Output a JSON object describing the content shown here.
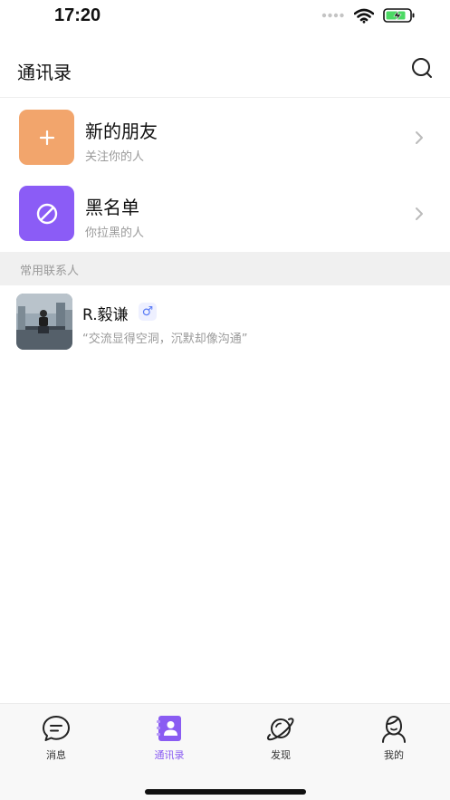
{
  "status_bar": {
    "time": "17:20"
  },
  "header": {
    "title": "通讯录",
    "search_icon": "search-icon"
  },
  "entries": [
    {
      "title": "新的朋友",
      "subtitle": "关注你的人",
      "icon": "plus-icon",
      "color": "#F2A56C"
    },
    {
      "title": "黑名单",
      "subtitle": "你拉黑的人",
      "icon": "block-icon",
      "color": "#8B5CF6"
    }
  ],
  "section": {
    "label": "常用联系人"
  },
  "contacts": [
    {
      "name": "R.毅谦",
      "gender_symbol": "♂",
      "signature": "“交流显得空洞，沉默却像沟通”"
    }
  ],
  "tabs": [
    {
      "label": "消息",
      "icon": "message-icon",
      "active": false
    },
    {
      "label": "通讯录",
      "icon": "contacts-icon",
      "active": true
    },
    {
      "label": "发现",
      "icon": "planet-icon",
      "active": false
    },
    {
      "label": "我的",
      "icon": "profile-icon",
      "active": false
    }
  ],
  "colors": {
    "accent": "#8A5CF2",
    "gender": "#5B7CF6"
  }
}
